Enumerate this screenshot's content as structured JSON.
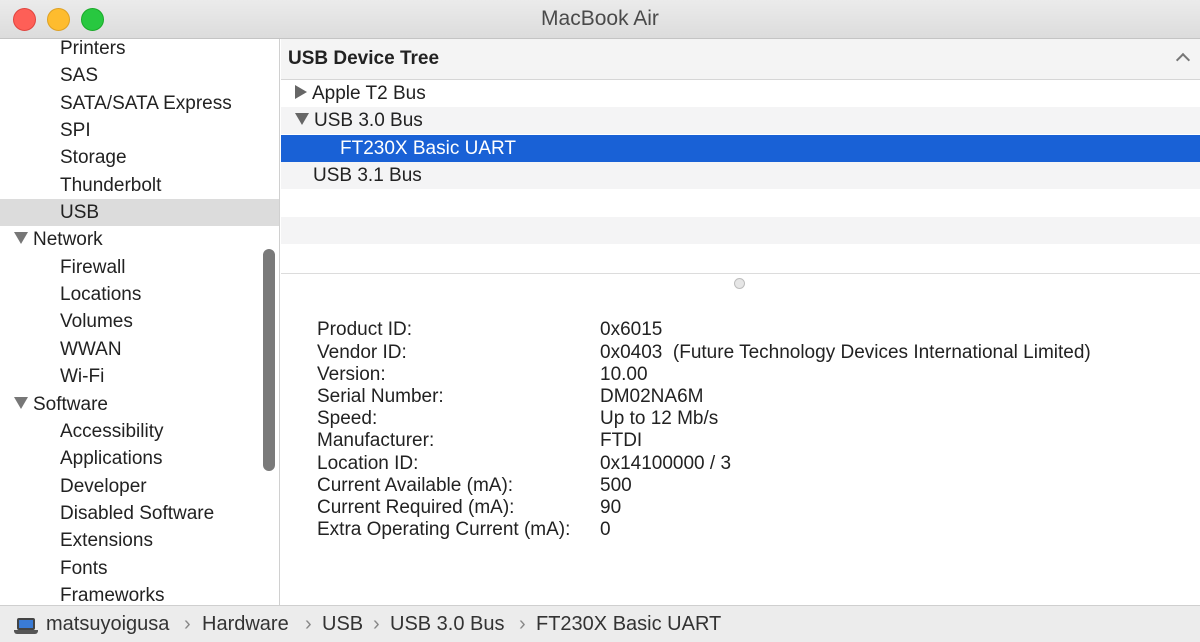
{
  "window": {
    "title": "MacBook Air"
  },
  "sidebar": {
    "items": [
      {
        "label": "Printers",
        "kind": "child"
      },
      {
        "label": "SAS",
        "kind": "child"
      },
      {
        "label": "SATA/SATA Express",
        "kind": "child"
      },
      {
        "label": "SPI",
        "kind": "child"
      },
      {
        "label": "Storage",
        "kind": "child"
      },
      {
        "label": "Thunderbolt",
        "kind": "child"
      },
      {
        "label": "USB",
        "kind": "child",
        "selected": true
      },
      {
        "label": "Network",
        "kind": "group"
      },
      {
        "label": "Firewall",
        "kind": "child"
      },
      {
        "label": "Locations",
        "kind": "child"
      },
      {
        "label": "Volumes",
        "kind": "child"
      },
      {
        "label": "WWAN",
        "kind": "child"
      },
      {
        "label": "Wi-Fi",
        "kind": "child"
      },
      {
        "label": "Software",
        "kind": "group"
      },
      {
        "label": "Accessibility",
        "kind": "child"
      },
      {
        "label": "Applications",
        "kind": "child"
      },
      {
        "label": "Developer",
        "kind": "child"
      },
      {
        "label": "Disabled Software",
        "kind": "child"
      },
      {
        "label": "Extensions",
        "kind": "child"
      },
      {
        "label": "Fonts",
        "kind": "child"
      },
      {
        "label": "Frameworks",
        "kind": "child"
      }
    ]
  },
  "tree": {
    "header": "USB Device Tree",
    "rows": [
      {
        "label": "Apple T2 Bus",
        "disclosure": "collapsed"
      },
      {
        "label": "USB 3.0 Bus",
        "disclosure": "expanded"
      },
      {
        "label": "FT230X Basic UART",
        "disclosure": "none",
        "selected": true
      },
      {
        "label": "USB 3.1 Bus",
        "disclosure": "none"
      }
    ]
  },
  "details": [
    {
      "key": "Product ID:",
      "value": "0x6015"
    },
    {
      "key": "Vendor ID:",
      "value": "0x0403  (Future Technology Devices International Limited)"
    },
    {
      "key": "Version:",
      "value": "10.00"
    },
    {
      "key": "Serial Number:",
      "value": "DM02NA6M"
    },
    {
      "key": "Speed:",
      "value": "Up to 12 Mb/s"
    },
    {
      "key": "Manufacturer:",
      "value": "FTDI"
    },
    {
      "key": "Location ID:",
      "value": "0x14100000 / 3"
    },
    {
      "key": "Current Available (mA):",
      "value": "500"
    },
    {
      "key": "Current Required (mA):",
      "value": "90"
    },
    {
      "key": "Extra Operating Current (mA):",
      "value": "0"
    }
  ],
  "pathbar": {
    "icon": "laptop-icon",
    "crumbs": [
      "matsuyoigusa",
      "Hardware",
      "USB",
      "USB 3.0 Bus",
      "FT230X Basic UART"
    ],
    "separator": "›"
  },
  "colors": {
    "selection": "#1961d6",
    "sidebar_selection": "#dcdcdc",
    "close": "#fe5f57",
    "minimize": "#febc2e",
    "maximize": "#28c840"
  }
}
